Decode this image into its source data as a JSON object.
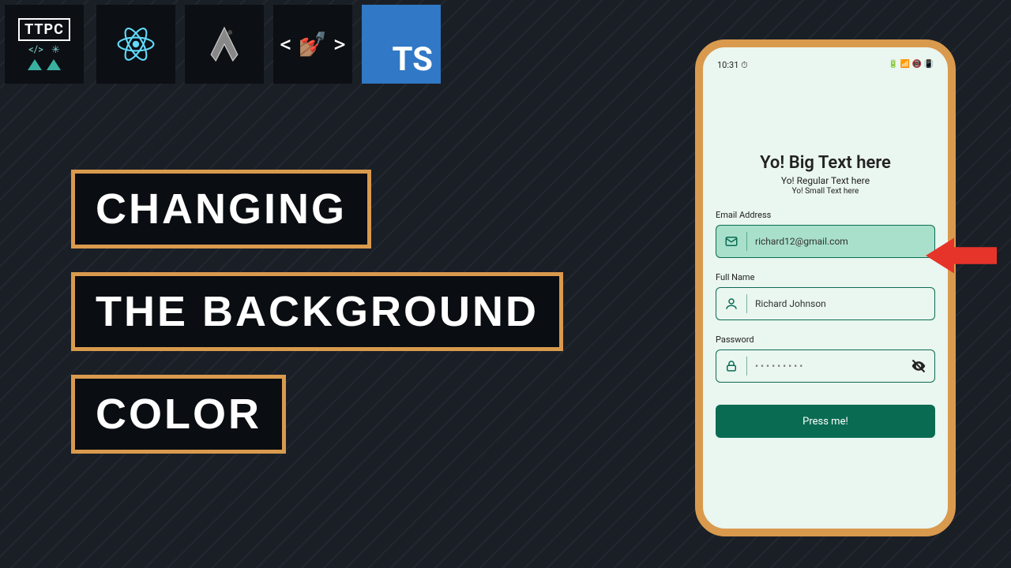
{
  "logo": {
    "text": "TTPC"
  },
  "tech_icons": [
    "react-icon",
    "expo-icon",
    "nail-polish-icon",
    "typescript-icon"
  ],
  "ts_label": "TS",
  "title": {
    "line1": "CHANGING",
    "line2": "THE BACKGROUND",
    "line3": "COLOR"
  },
  "phone": {
    "status_time": "10:31 ⏱",
    "status_right": "🔋 📶 📵 📳",
    "heading_big": "Yo! Big Text here",
    "heading_reg": "Yo! Regular Text here",
    "heading_sml": "Yo! Small Text here",
    "fields": {
      "email": {
        "label": "Email Address",
        "value": "richard12@gmail.com"
      },
      "name": {
        "label": "Full Name",
        "value": "Richard Johnson"
      },
      "pass": {
        "label": "Password",
        "value": "• • • • • • • • •"
      }
    },
    "button_label": "Press me!"
  },
  "colors": {
    "accent": "#d99a4e",
    "green": "#0a6b53",
    "mint": "#eaf6f0"
  }
}
